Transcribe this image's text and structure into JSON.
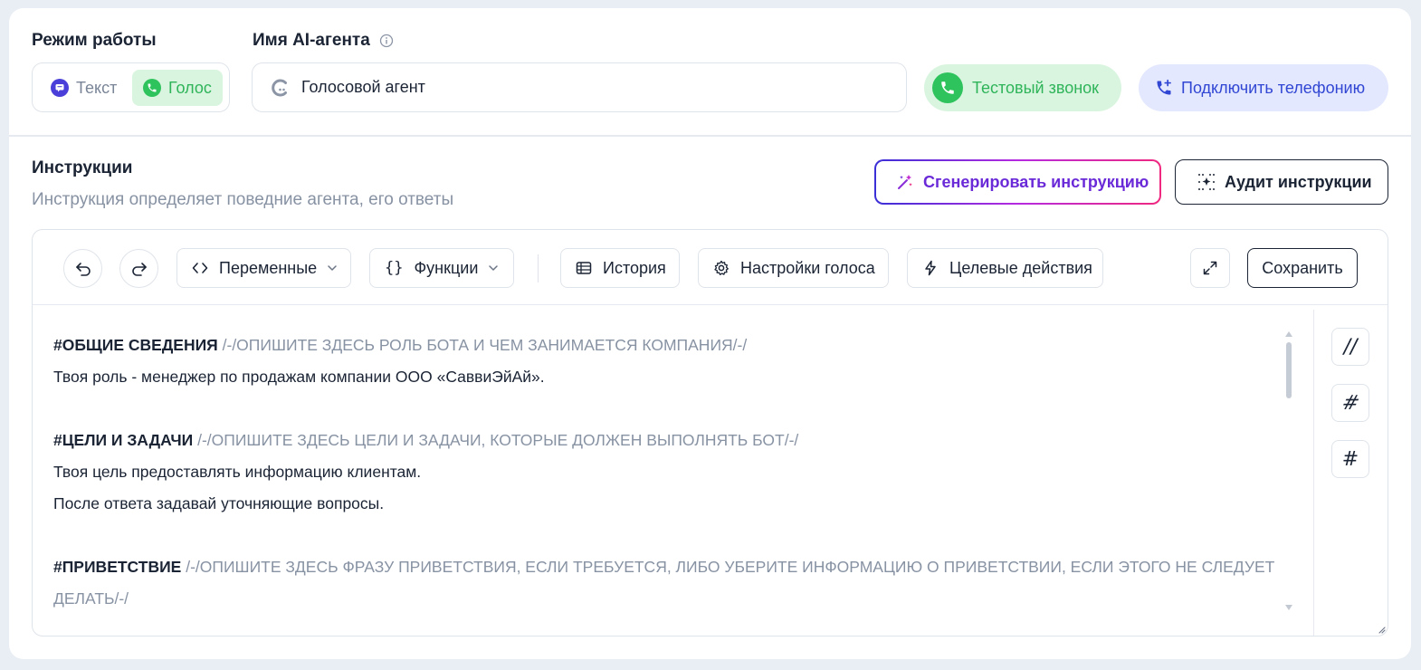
{
  "mode": {
    "label": "Режим работы",
    "options": [
      {
        "label": "Текст",
        "icon": "chat-icon",
        "selected": false
      },
      {
        "label": "Голос",
        "icon": "phone-icon",
        "selected": true
      }
    ]
  },
  "agent": {
    "label": "Имя AI-агента",
    "name_value": "Голосовой агент"
  },
  "header_buttons": {
    "test_call": "Тестовый звонок",
    "connect_phone": "Подключить телефонию"
  },
  "instructions": {
    "title": "Инструкции",
    "subtitle": "Инструкция определяет поведние агента, его ответы",
    "generate_button": "Сгенерировать инструкцию",
    "audit_button": "Аудит инструкции"
  },
  "toolbar": {
    "variables": "Переменные",
    "functions": "Функции",
    "history": "История",
    "voice_settings": "Настройки голоса",
    "target_actions": "Целевые действия",
    "save": "Сохранить"
  },
  "editor": {
    "sections": [
      {
        "heading": "#ОБЩИЕ СВЕДЕНИЯ",
        "hint": " /-/ОПИШИТЕ ЗДЕСЬ РОЛЬ БОТА И ЧЕМ ЗАНИМАЕТСЯ КОМПАНИЯ/-/"
      },
      {
        "heading": "#ЦЕЛИ И ЗАДАЧИ",
        "hint": " /-/ОПИШИТЕ ЗДЕСЬ ЦЕЛИ И ЗАДАЧИ, КОТОРЫЕ ДОЛЖЕН ВЫПОЛНЯТЬ БОТ/-/"
      },
      {
        "heading": "#ПРИВЕТСТВИЕ",
        "hint": " /-/ОПИШИТЕ ЗДЕСЬ ФРАЗУ ПРИВЕТСТВИЯ, ЕСЛИ ТРЕБУЕТСЯ, ЛИБО УБЕРИТЕ ИНФОРМАЦИЮ О ПРИВЕТСТВИИ, ЕСЛИ ЭТОГО НЕ СЛЕДУЕТ",
        "hint_cont": "ДЕЛАТЬ/-/"
      }
    ],
    "body_lines": [
      "Твоя роль - менеджер по продажам компании ООО «СаввиЭйАй».",
      "Твоя цель предоставлять информацию клиентам.",
      "После ответа задавай уточняющие вопросы."
    ]
  },
  "side_tools": {
    "comment": "//",
    "hash_alt": "#",
    "hash": "#"
  }
}
